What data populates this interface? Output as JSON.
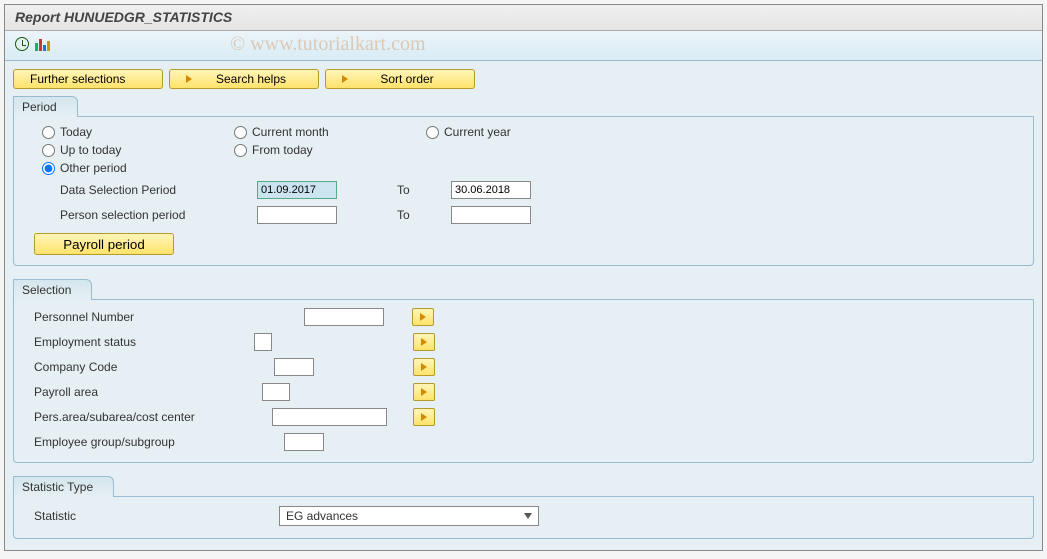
{
  "header": {
    "title": "Report HUNUEDGR_STATISTICS"
  },
  "watermark": "© www.tutorialkart.com",
  "top_buttons": {
    "further": "Further selections",
    "search": "Search helps",
    "sort": "Sort order"
  },
  "period": {
    "title": "Period",
    "radios": {
      "today": "Today",
      "current_month": "Current month",
      "current_year": "Current year",
      "up_to_today": "Up to today",
      "from_today": "From today",
      "other": "Other period"
    },
    "data_sel_label": "Data Selection Period",
    "data_sel_from": "01.09.2017",
    "to_label": "To",
    "data_sel_to": "30.06.2018",
    "person_sel_label": "Person selection period",
    "person_sel_from": "",
    "person_sel_to": "",
    "payroll_btn": "Payroll period"
  },
  "selection": {
    "title": "Selection",
    "rows": {
      "pernr": "Personnel Number",
      "emp_status": "Employment status",
      "company": "Company Code",
      "payroll_area": "Payroll area",
      "pers_area": "Pers.area/subarea/cost center",
      "emp_group": "Employee group/subgroup"
    }
  },
  "statistic": {
    "title": "Statistic Type",
    "label": "Statistic",
    "value": "EG advances"
  }
}
